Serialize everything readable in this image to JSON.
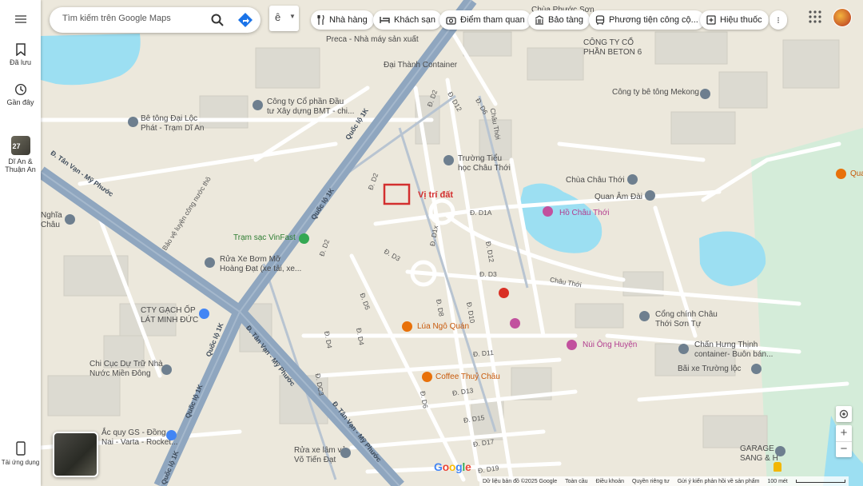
{
  "search": {
    "placeholder": "Tìm kiếm trên Google Maps"
  },
  "sidebar": {
    "saved_label": "Đã lưu",
    "recent_label": "Gần đây",
    "recent_place_label": "Dĩ An &\nThuận An",
    "recent_place_badge": "27",
    "bottom_label": "Tải ứng dụng"
  },
  "chips": [
    {
      "label": "Nhà hàng",
      "icon": "fork-knife-icon"
    },
    {
      "label": "Khách sạn",
      "icon": "bed-icon"
    },
    {
      "label": "Điểm tham quan",
      "icon": "camera-icon"
    },
    {
      "label": "Bảo tàng",
      "icon": "museum-icon"
    },
    {
      "label": "Phương tiện công cộ...",
      "icon": "bus-icon"
    },
    {
      "label": "Hiệu thuốc",
      "icon": "pharmacy-icon"
    }
  ],
  "map": {
    "marker_label": "Vị trí đất",
    "places": {
      "preca": "Preca - Nhà máy sản xuất",
      "dai_thanh": "Đại Thành Container",
      "beton6": "CÔNG TY CỔ\nPHẦN BETON 6",
      "mekong": "Công ty bê tông Mekong",
      "chua_phuoc_son": "Chùa Phước Sơn",
      "cong_ty_dau_tu": "Công ty Cổ phần Đầu\ntư Xây dựng BMT - chi...",
      "be_tong_dai_loc": "Bê tông Đại Lộc\nPhát - Trạm Dĩ An",
      "truong_tieu_hoc": "Trường Tiểu\nhọc Châu Thới",
      "chua_chau_thoi": "Chùa Châu Thới",
      "quan_am_dai": "Quan Âm Đài",
      "ho_chau_thoi": "Hồ Châu Thới",
      "quan_partial": "Qua",
      "nghia_chau": "Nghĩa\nChâu",
      "tram_sac": "Trạm sạc VinFast",
      "rua_xe_hoang_dat": "Rửa Xe Bơm Mỡ\nHoàng Đạt (xe tải, xe...",
      "cty_gach": "CTY GẠCH ỐP\nLÁT MINH ĐỨC",
      "lua_ngo_quan": "Lúa Ngô Quán",
      "nui_ong_huyen": "Núi Ông Huyện",
      "cong_chinh": "Cổng chính Châu\nThới Sơn Tự",
      "chan_hung_thinh": "Chấn Hưng Thịnh\ncontainer- Buôn bán...",
      "bai_xe": "Bãi xe Trường lộc",
      "chi_cuc": "Chi Cục Dự Trữ Nhà\nNước Miền Đông",
      "coffee": "Coffee Thuỷ Châu",
      "ac_quy": "Ắc quy GS - Đồng\nNai - Varta - Rocket...",
      "rua_xe_vo_tien_dat": "Rửa xe lâm vỏ\nVõ Tiến Đạt",
      "garage": "GARAGE\nSANG & H"
    },
    "roads": {
      "ql1k_a": "Quốc lộ 1K",
      "ql1k_b": "Quốc lộ 1K",
      "ql1k_c": "Quốc lộ 1K",
      "ql1k_d": "Quốc lộ 1K",
      "ql1k_e": "Quốc lộ 1K",
      "dt_a": "Đ. Tân Vạn - Mỹ Phước",
      "dt_b": "Đ. Tân Vạn - Mỹ Phước",
      "dt_c": "Đ. Tân Vạn - Mỹ Phước",
      "chau_thoi": "Châu Thới",
      "chau_thoi_2": "Châu Thới",
      "bao_ve": "Bảo vệ luyện công nước thô",
      "d2a": "Đ. D2",
      "d2b": "Đ. D2",
      "d2c": "Đ. D2",
      "d12": "Đ. D12",
      "d6": "Đ. D6",
      "d1a": "Đ. D1A",
      "d3": "Đ. D3",
      "d3b": "Đ. D3",
      "d5": "Đ. D5",
      "d4": "Đ. D4",
      "d8": "Đ. D8",
      "d10": "Đ. D10",
      "d11": "Đ. D11",
      "d13": "Đ. D13",
      "d15": "Đ. D15",
      "d17": "Đ. D17",
      "d19": "Đ. D19",
      "dc3": "Đ. DC3",
      "d12b": "Đ. D12",
      "d1x": "Đ. D1x",
      "d4b": "Đ. D4",
      "d6b": "Đ. D6"
    }
  },
  "footer": {
    "data": "Dữ liệu bản đồ ©2025 Google",
    "items": [
      "Toàn cầu",
      "Điều khoản",
      "Quyền riêng tư",
      "Gửi ý kiến phản hồi về sản phẩm"
    ],
    "scale": "100 mét"
  },
  "colors": {
    "water": "#9cdff2",
    "main_road": "#8fa6bf",
    "red_marker": "#d32f2f"
  }
}
